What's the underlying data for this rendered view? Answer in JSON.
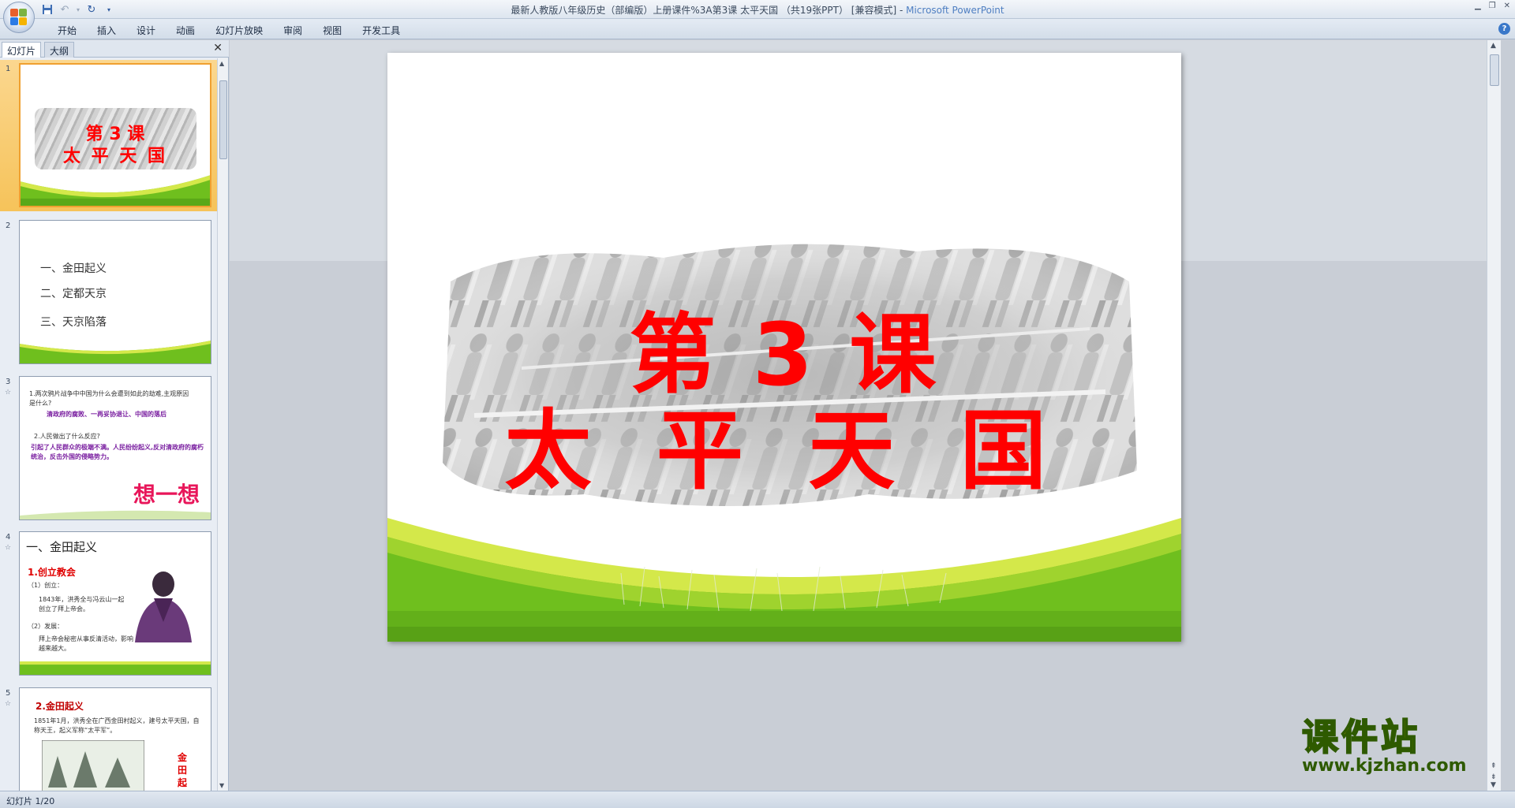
{
  "window": {
    "title_doc": "最新人教版八年级历史（部编版）上册课件%3A第3课   太平天国 （共19张PPT） [兼容模式] - ",
    "title_app": "Microsoft PowerPoint"
  },
  "ribbon": {
    "tabs": [
      "开始",
      "插入",
      "设计",
      "动画",
      "幻灯片放映",
      "审阅",
      "视图",
      "开发工具"
    ]
  },
  "left_pane": {
    "tab_slides": "幻灯片",
    "tab_outline": "大纲",
    "close": "✕"
  },
  "thumbnails": [
    {
      "num": "1",
      "line1": "第 3 课",
      "line2": "太 平 天 国"
    },
    {
      "num": "2",
      "items": [
        "一、金田起义",
        "二、定都天京",
        "三、天京陷落"
      ]
    },
    {
      "num": "3",
      "q1": "1.两次鸦片战争中中国为什么会遭到如此的劫难,主观原因是什么?",
      "a1": "清政府的腐败、一再妥协退让、中国的落后",
      "q2": "2.人民做出了什么反应?",
      "a2": "引起了人民群众的极端不满。人民纷纷起义,反对清政府的腐朽统治，反击外国的侵略势力。",
      "big": "想一想"
    },
    {
      "num": "4",
      "heading": "一、金田起义",
      "sub": "1.创立教会",
      "p1_label": "（1）创立：",
      "p1": "1843年，洪秀全与冯云山一起创立了拜上帝会。",
      "p2_label": "（2）发展：",
      "p2": "拜上帝会秘密从事反清活动，影响越来越大。"
    },
    {
      "num": "5",
      "heading": "2.金田起义",
      "body": "1851年1月，洪秀全在广西金田村起义，建号太平天国，自称天王，起义军称“太平军”。",
      "side": "金田起"
    }
  ],
  "slide": {
    "line1": "第 3 课",
    "line2": "太 平 天 国"
  },
  "watermark": {
    "cn": "课件站",
    "url": "www.kjzhan.com"
  },
  "status": {
    "slide_indicator": "幻灯片 1/20"
  },
  "colors": {
    "title_red": "#ff0000",
    "green_band": "#6fbf1e",
    "selection": "#f6c35a"
  }
}
